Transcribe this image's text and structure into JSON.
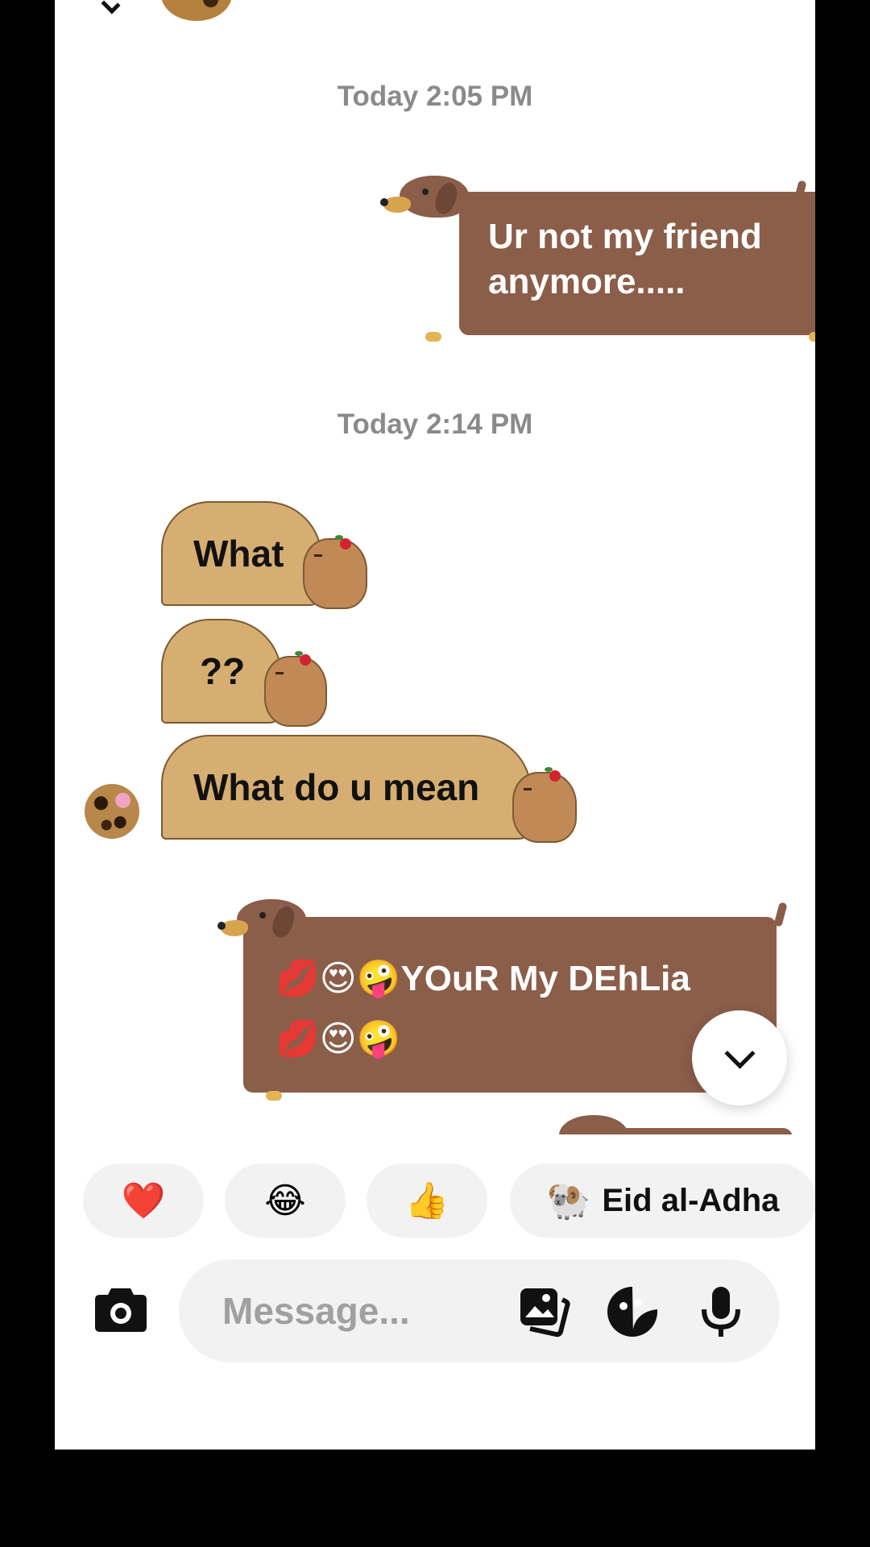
{
  "timestamps": [
    "Today 2:05 PM",
    "Today 2:14 PM"
  ],
  "messages": [
    {
      "direction": "outgoing",
      "text": "Ur not my friend\nanymore....."
    },
    {
      "direction": "incoming",
      "text": "What"
    },
    {
      "direction": "incoming",
      "text": "??"
    },
    {
      "direction": "incoming",
      "text": "What do u mean"
    },
    {
      "direction": "outgoing",
      "text": "💋😍🤪YOuR My DEhLia\n💋😍🤪"
    }
  ],
  "quick_reactions": [
    {
      "emoji": "❤️",
      "icon": "heart-icon"
    },
    {
      "emoji": "😂",
      "icon": "tears-of-joy-icon"
    },
    {
      "emoji": "👍",
      "icon": "thumbs-up-icon"
    },
    {
      "emoji": "🐏",
      "label": "Eid al-Adha",
      "icon": "ram-icon"
    }
  ],
  "composer": {
    "placeholder": "Message...",
    "icons": [
      "camera-icon",
      "gallery-icon",
      "sticker-icon",
      "microphone-icon"
    ]
  },
  "colors": {
    "outgoing_bubble": "#8b5e4a",
    "incoming_bubble": "#d6ae72",
    "timestamp": "#8a8a8a",
    "composer_bg": "#f2f2f2"
  }
}
